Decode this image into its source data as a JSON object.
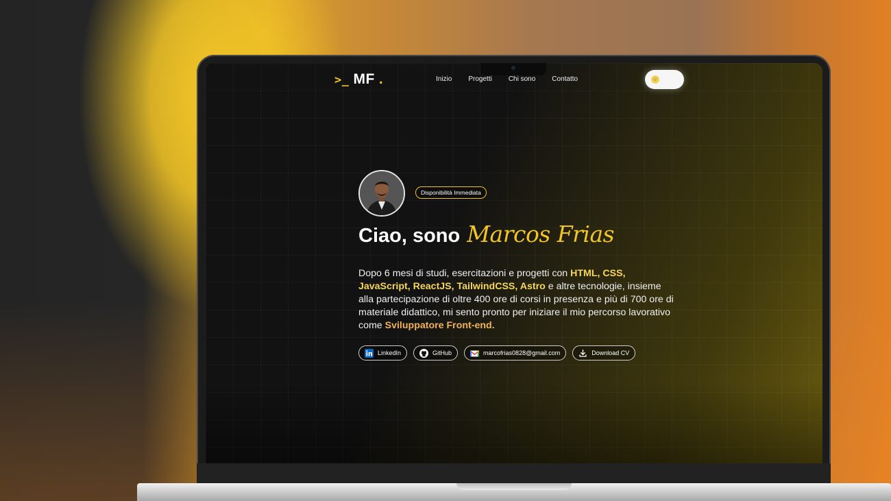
{
  "logo": {
    "prompt": ">_",
    "initials": "MF",
    "dot": "."
  },
  "nav": {
    "items": [
      "Inizio",
      "Progetti",
      "Chi sono",
      "Contatto"
    ]
  },
  "theme_toggle": {
    "icon": "sun-face-icon",
    "state": "light"
  },
  "hero": {
    "badge": "Disponibilità Immediata",
    "greeting": "Ciao, sono",
    "name": "Marcos Frias",
    "desc_p1": "Dopo 6 mesi di studi, esercitazioni e progetti con ",
    "desc_hl1": "HTML, CSS, JavaScript, ReactJS, TailwindCSS, Astro",
    "desc_p2": " e altre tecnologie, insieme alla partecipazione di oltre 400 ore di corsi in presenza e più di 700 ore di materiale didattico, mi sento pronto per iniziare il mio percorso lavorativo come ",
    "desc_hl2": "Sviluppatore Front-end."
  },
  "links": {
    "linkedin": "LinkedIn",
    "github": "GitHub",
    "email": "marcofrias0828@gmail.com",
    "cv": "Download CV"
  },
  "colors": {
    "accent": "#f2c526",
    "highlight": "#f7d75a",
    "role_highlight": "#f0b35a",
    "screen_bg": "#121212"
  }
}
